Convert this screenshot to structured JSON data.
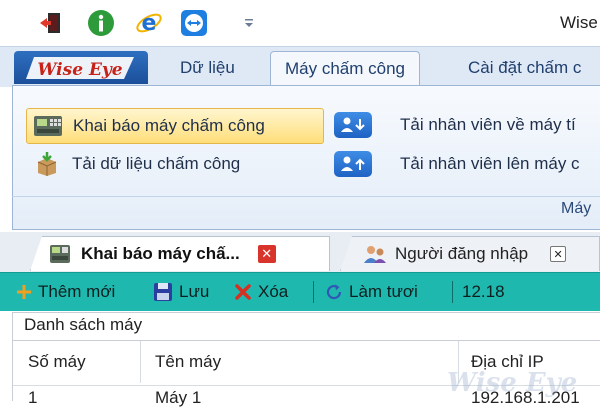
{
  "app": {
    "title": "Wise"
  },
  "quick_access": [
    {
      "icon": "exit-door-icon"
    },
    {
      "icon": "info-icon"
    },
    {
      "icon": "internet-explorer-icon"
    },
    {
      "icon": "remote-support-icon"
    },
    {
      "icon": "customize-dropdown-icon"
    }
  ],
  "ribbon": {
    "logo_text": "Wise Eye",
    "tabs": [
      {
        "label": "Dữ liệu"
      },
      {
        "label": "Máy chấm công",
        "active": true
      },
      {
        "label": "Cài đặt chấm c"
      }
    ],
    "buttons": {
      "declare_machine": "Khai báo máy chấm công",
      "load_attendance": "Tải dữ liệu chấm công",
      "download_staff": "Tải nhân viên về máy tí",
      "upload_staff": "Tải nhân viên lên máy c"
    },
    "group_label": "Máy"
  },
  "doc_tabs": [
    {
      "label": "Khai báo máy chấ...",
      "active": true
    },
    {
      "label": "Người đăng nhập"
    }
  ],
  "toolbar": {
    "add": "Thêm mới",
    "save": "Lưu",
    "delete": "Xóa",
    "refresh": "Làm tươi",
    "value": "12.18"
  },
  "machine_list": {
    "section_title": "Danh sách máy",
    "columns": [
      "Số máy",
      "Tên máy",
      "Địa chỉ IP"
    ],
    "rows": [
      [
        "1",
        "Máy 1",
        "192.168.1.201"
      ]
    ]
  },
  "watermark": "Wise Eye",
  "colors": {
    "toolbar": "#1fb8ae",
    "ribbon_accent": "#1b4f9a",
    "close": "#d9342b"
  }
}
